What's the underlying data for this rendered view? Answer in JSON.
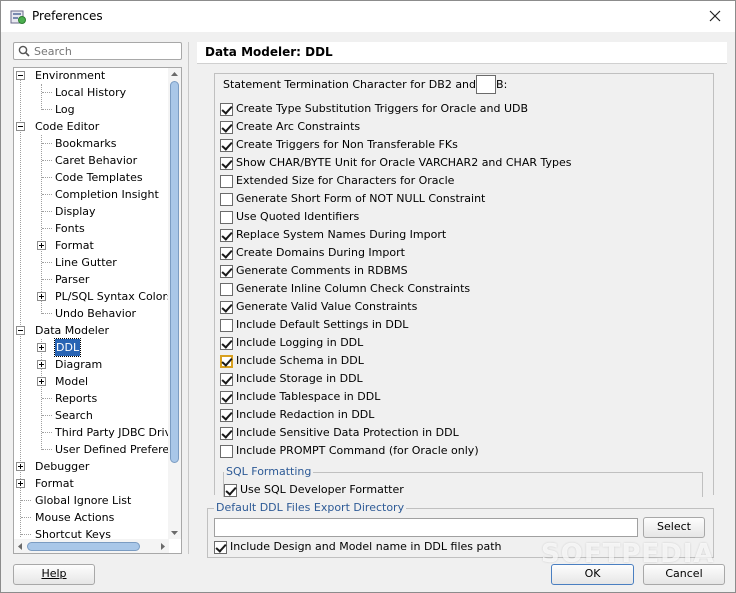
{
  "window": {
    "title": "Preferences"
  },
  "search": {
    "placeholder": "Search"
  },
  "tree": {
    "nodes": [
      {
        "label": "Environment",
        "expanded": true
      },
      {
        "label": "Local History"
      },
      {
        "label": "Log"
      },
      {
        "label": "Code Editor",
        "expanded": true
      },
      {
        "label": "Bookmarks"
      },
      {
        "label": "Caret Behavior"
      },
      {
        "label": "Code Templates"
      },
      {
        "label": "Completion Insight"
      },
      {
        "label": "Display"
      },
      {
        "label": "Fonts"
      },
      {
        "label": "Format",
        "expanded": false
      },
      {
        "label": "Line Gutter"
      },
      {
        "label": "Parser"
      },
      {
        "label": "PL/SQL Syntax Colors",
        "expanded": false
      },
      {
        "label": "Undo Behavior"
      },
      {
        "label": "Data Modeler",
        "expanded": true
      },
      {
        "label": "DDL",
        "expanded": false,
        "selected": true
      },
      {
        "label": "Diagram",
        "expanded": false
      },
      {
        "label": "Model",
        "expanded": false
      },
      {
        "label": "Reports"
      },
      {
        "label": "Search"
      },
      {
        "label": "Third Party JDBC Driver"
      },
      {
        "label": "User Defined Preference"
      },
      {
        "label": "Debugger",
        "expanded": false
      },
      {
        "label": "Format",
        "expanded": false
      },
      {
        "label": "Global Ignore List"
      },
      {
        "label": "Mouse Actions"
      },
      {
        "label": "Shortcut Keys"
      }
    ]
  },
  "panel": {
    "title": "Data Modeler: DDL",
    "termination_label": "Statement Termination Character for DB2 and UDB:",
    "options": [
      {
        "label": "Create Type Substitution Triggers for Oracle and UDB",
        "checked": true
      },
      {
        "label": "Create Arc Constraints",
        "checked": true
      },
      {
        "label": "Create Triggers for Non Transferable FKs",
        "checked": true
      },
      {
        "label": "Show CHAR/BYTE Unit for Oracle VARCHAR2 and CHAR Types",
        "checked": true
      },
      {
        "label": "Extended Size for Characters for Oracle",
        "checked": false
      },
      {
        "label": "Generate Short Form of NOT NULL Constraint",
        "checked": false
      },
      {
        "label": "Use Quoted Identifiers",
        "checked": false
      },
      {
        "label": "Replace System Names During Import",
        "checked": true
      },
      {
        "label": "Create Domains During Import",
        "checked": true
      },
      {
        "label": "Generate Comments in RDBMS",
        "checked": true
      },
      {
        "label": "Generate Inline Column Check Constraints",
        "checked": false
      },
      {
        "label": "Generate Valid Value Constraints",
        "checked": true
      },
      {
        "label": "Include Default Settings in DDL",
        "checked": false
      },
      {
        "label": "Include Logging in DDL",
        "checked": true
      },
      {
        "label": "Include Schema in DDL",
        "checked": true,
        "focused": true
      },
      {
        "label": "Include Storage in DDL",
        "checked": true
      },
      {
        "label": "Include Tablespace in DDL",
        "checked": true
      },
      {
        "label": "Include Redaction in DDL",
        "checked": true
      },
      {
        "label": "Include Sensitive Data Protection in DDL",
        "checked": true
      },
      {
        "label": "Include PROMPT Command (for Oracle only)",
        "checked": false
      }
    ],
    "sql_formatting": {
      "legend": "SQL Formatting",
      "option": {
        "label": "Use SQL Developer Formatter",
        "checked": true
      }
    },
    "export_dir": {
      "legend": "Default DDL Files Export Directory",
      "value": "",
      "select_label": "Select",
      "include_option": {
        "label": "Include Design and Model name in DDL files path",
        "checked": true
      }
    }
  },
  "footer": {
    "help_label": "Help",
    "ok_label": "OK",
    "cancel_label": "Cancel"
  },
  "watermark": "SOFTPEDIA"
}
